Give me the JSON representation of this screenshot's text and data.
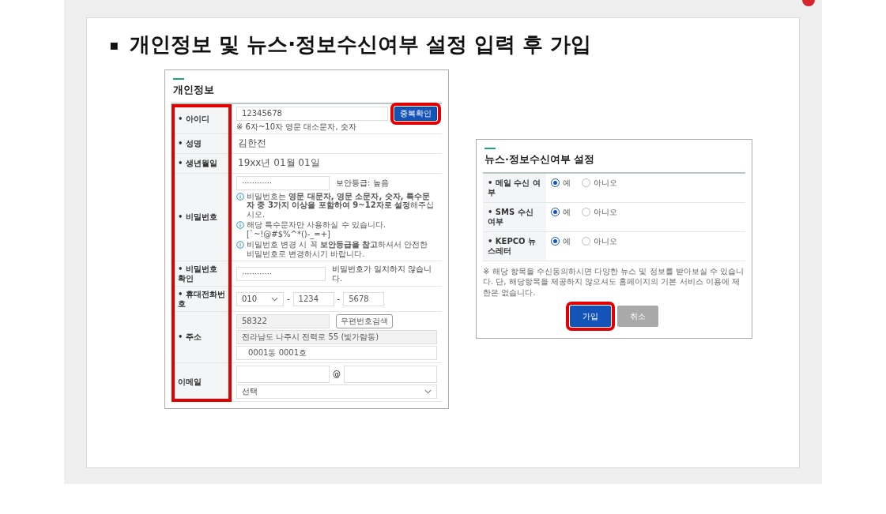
{
  "slide": {
    "bullet": "▪",
    "title": "개인정보 및 뉴스·정보수신여부 설정 입력 후 가입"
  },
  "personal_form": {
    "title": "개인정보",
    "label_column_highlighted": true,
    "fields": [
      {
        "kind": "id",
        "label": "• 아이디",
        "value": "12345678",
        "button": {
          "label": "중복확인",
          "highlighted": true
        },
        "hint": "※ 6자~10자 영문 대소문자, 숫자"
      },
      {
        "kind": "text",
        "label": "• 성명",
        "value": "김한전"
      },
      {
        "kind": "text",
        "label": "• 생년월일",
        "value": "19xx년 01월 01일"
      },
      {
        "kind": "password",
        "label": "• 비밀번호",
        "value": "············",
        "message": "보안등급: 높음",
        "notes": [
          "비밀번호는 **영문 대문자, 영문 소문자, 숫자, 특수문자 중 3가지 이상을 포함하여 9~12자로 설정**해주십시오.",
          "해당 특수문자만 사용하실 수 있습니다.[`~!@#$%^*()-_=+]",
          "비밀번호 변경 시 꼭 **보안등급을 참고**하셔서 안전한 비밀번호로 변경하시기 바랍니다."
        ]
      },
      {
        "kind": "password",
        "label": "• 비밀번호 확인",
        "value": "············",
        "message": "비밀번호가 일치하지 않습니다."
      },
      {
        "kind": "phone",
        "label": "• 휴대전화번호",
        "prefix": "010",
        "separator": "-",
        "parts": [
          "1234",
          "5678"
        ]
      },
      {
        "kind": "address",
        "label": "• 주소",
        "zip": "58322",
        "button": {
          "label": "우편번호검색"
        },
        "address": "전라남도 나주시 전력로 55 (빛가람동)",
        "detail": "0001동 0001호"
      },
      {
        "kind": "email",
        "label": "이메일",
        "at": "@",
        "select": "선택"
      }
    ]
  },
  "news_form": {
    "title": "뉴스·정보수신여부 설정",
    "options": [
      {
        "label": "• 메일 수신 여부",
        "choices": [
          {
            "label": "예",
            "selected": true
          },
          {
            "label": "아니오",
            "selected": false
          }
        ]
      },
      {
        "label": "• SMS 수신 여부",
        "choices": [
          {
            "label": "예",
            "selected": true
          },
          {
            "label": "아니오",
            "selected": false
          }
        ]
      },
      {
        "label": "• KEPCO 뉴스레터",
        "choices": [
          {
            "label": "예",
            "selected": true
          },
          {
            "label": "아니오",
            "selected": false
          }
        ]
      }
    ],
    "note": "※ 해당 항목을 수신동의하시면 다양한 뉴스 및 정보를 받아보실 수 있습니다. 단, 해당항목을 제공하지 않으셔도 홈페이지의 기본 서비스 이용에 제한은 없습니다.",
    "buttons": [
      {
        "kind": "primary",
        "label": "가입",
        "highlighted": true
      },
      {
        "kind": "secondary",
        "label": "취소",
        "highlighted": false
      }
    ]
  }
}
